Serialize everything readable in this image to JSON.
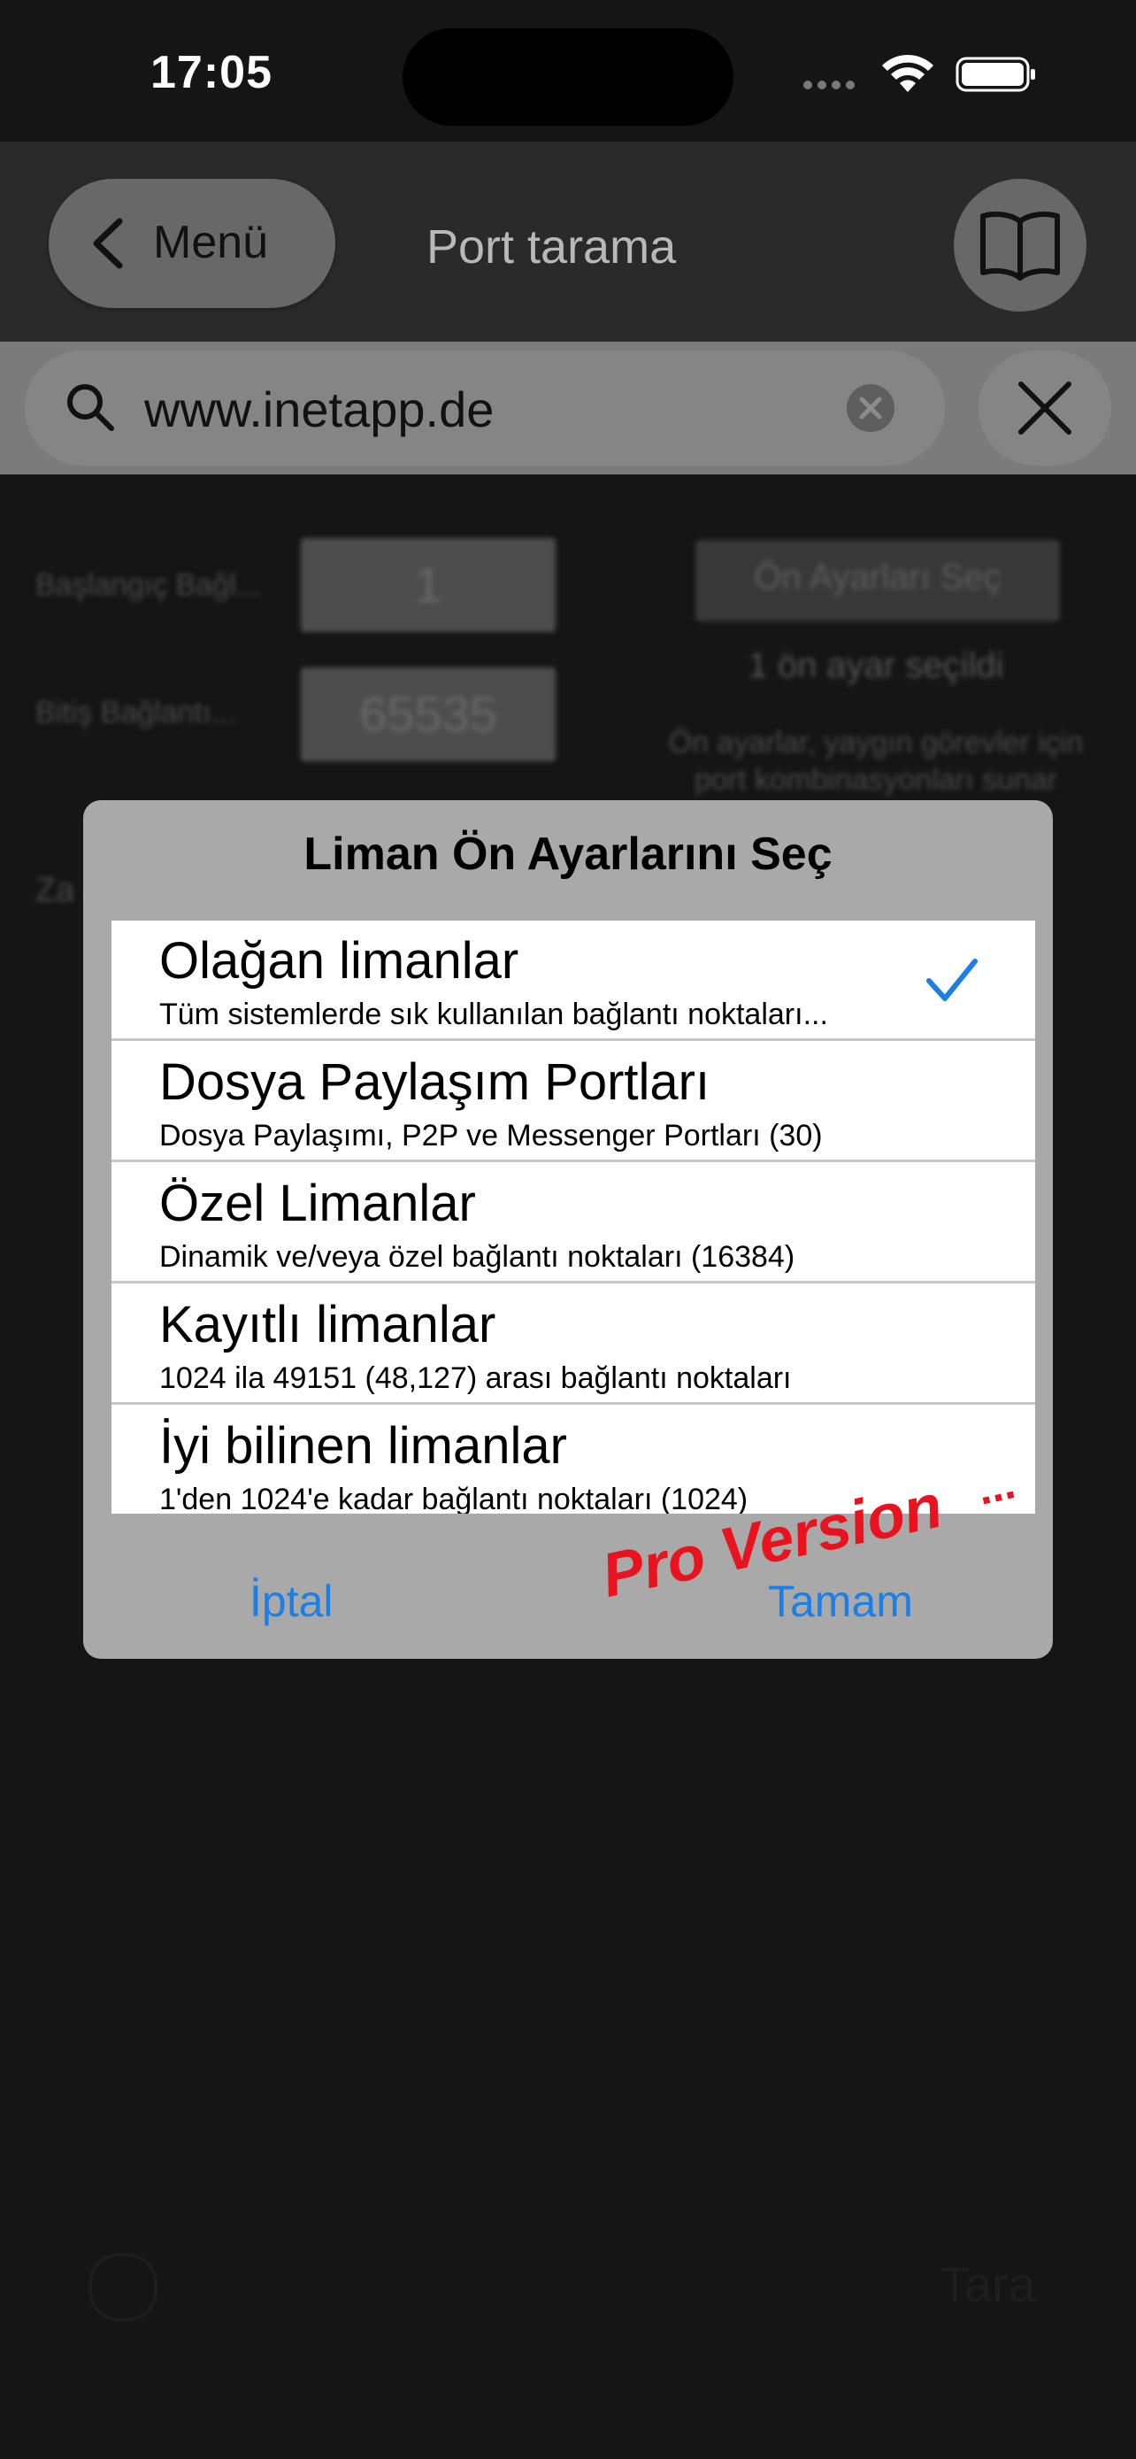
{
  "status_bar": {
    "time": "17:05"
  },
  "nav": {
    "back_label": "Menü",
    "title": "Port tarama"
  },
  "search": {
    "value": "www.inetapp.de"
  },
  "form": {
    "start_label": "Başlangıç Bağl...",
    "start_value": "1",
    "end_label": "Bitiş Bağlantı...",
    "end_value": "65535",
    "preset_button": "Ön Ayarları Seç",
    "preset_count": "1 ön ayar seçildi",
    "preset_desc_1": "Ön ayarlar, yaygın görevler için",
    "preset_desc_2": "port kombinasyonları sunar",
    "partial_label": "Za"
  },
  "dialog": {
    "title": "Liman Ön Ayarlarını Seç",
    "items": [
      {
        "title": "Olağan limanlar",
        "subtitle": "Tüm sistemlerde sık kullanılan bağlantı noktaları...",
        "selected": true
      },
      {
        "title": "Dosya Paylaşım Portları",
        "subtitle": "Dosya Paylaşımı, P2P ve Messenger Portları (30)",
        "selected": false
      },
      {
        "title": "Özel Limanlar",
        "subtitle": "Dinamik ve/veya özel bağlantı noktaları (16384)",
        "selected": false
      },
      {
        "title": "Kayıtlı limanlar",
        "subtitle": "1024 ila 49151 (48,127) arası bağlantı noktaları",
        "selected": false
      },
      {
        "title": "İyi bilinen limanlar",
        "subtitle": "1'den 1024'e kadar bağlantı noktaları (1024)",
        "selected": false
      }
    ],
    "cancel_label": "İptal",
    "ok_label": "Tamam",
    "pro_badge": "Pro Version",
    "pro_dots": "..."
  },
  "toolbar": {
    "scan_label": "Tara"
  },
  "colors": {
    "accent": "#1a7fe6",
    "pro": "#e8131e"
  }
}
